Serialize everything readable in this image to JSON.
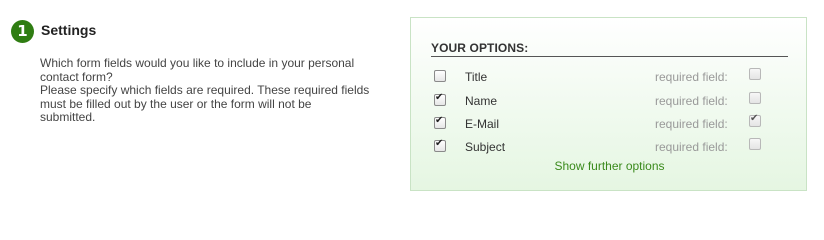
{
  "step": {
    "number": "1",
    "title": "Settings"
  },
  "description": {
    "line1": "Which form fields would you like to include in your personal contact form?",
    "line2": "Please specify which fields are required. These required fields must be filled out by the user or the form will not be submitted."
  },
  "options": {
    "heading": "YOUR OPTIONS:",
    "required_label": "required field:",
    "fields": [
      {
        "label": "Title",
        "included": false,
        "required": false
      },
      {
        "label": "Name",
        "included": true,
        "required": false
      },
      {
        "label": "E-Mail",
        "included": true,
        "required": true
      },
      {
        "label": "Subject",
        "included": true,
        "required": false
      }
    ],
    "further_link": "Show further options"
  },
  "colors": {
    "accent": "#2f7d12",
    "link": "#3a8a1c",
    "panel_border": "#c9e3c5"
  }
}
